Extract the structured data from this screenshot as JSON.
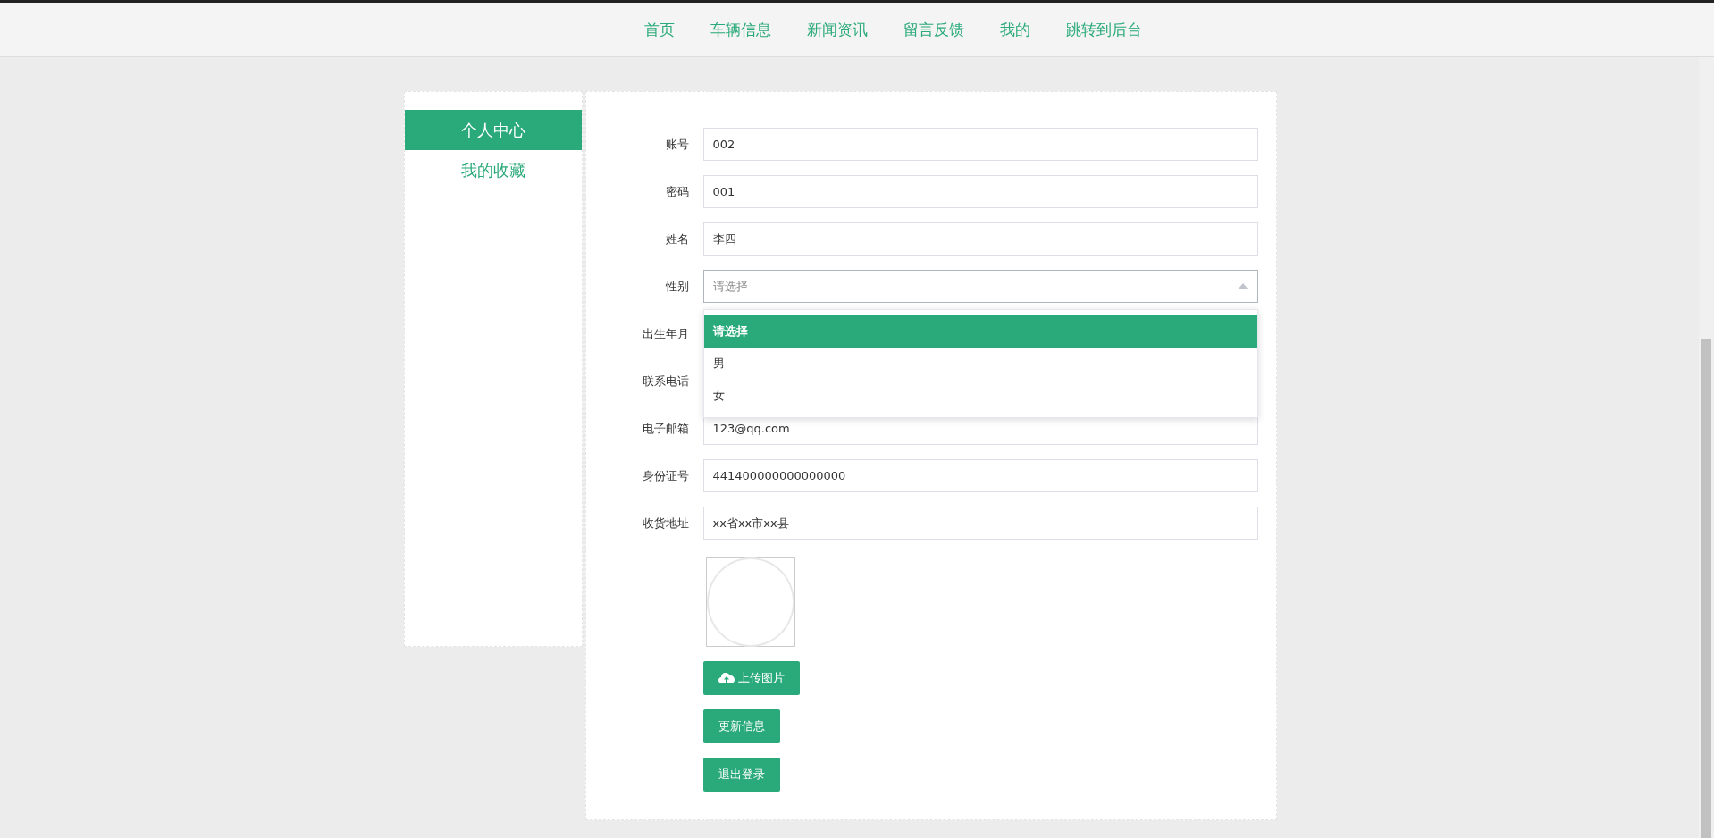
{
  "nav": {
    "items": [
      {
        "label": "首页"
      },
      {
        "label": "车辆信息"
      },
      {
        "label": "新闻资讯"
      },
      {
        "label": "留言反馈"
      },
      {
        "label": "我的"
      },
      {
        "label": "跳转到后台"
      }
    ]
  },
  "sidebar": {
    "items": [
      {
        "label": "个人中心",
        "selected": true
      },
      {
        "label": "我的收藏",
        "selected": false
      }
    ]
  },
  "form": {
    "fields": [
      {
        "label": "账号",
        "kind": "text",
        "value": "002"
      },
      {
        "label": "密码",
        "kind": "text",
        "value": "001"
      },
      {
        "label": "姓名",
        "kind": "text",
        "value": "李四"
      },
      {
        "label": "性别",
        "kind": "select",
        "placeholder": "请选择",
        "expanded": true,
        "options": [
          {
            "label": "请选择",
            "selected": true
          },
          {
            "label": "男",
            "selected": false
          },
          {
            "label": "女",
            "selected": false
          }
        ]
      },
      {
        "label": "出生年月",
        "kind": "text"
      },
      {
        "label": "联系电话",
        "kind": "text"
      },
      {
        "label": "电子邮箱",
        "kind": "text",
        "value": "123@qq.com"
      },
      {
        "label": "身份证号",
        "kind": "text",
        "value": "441400000000000000"
      },
      {
        "label": "收货地址",
        "kind": "text",
        "value": "xx省xx市xx县"
      }
    ],
    "upload_button": "上传图片",
    "buttons": [
      "更新信息",
      "退出登录"
    ]
  }
}
